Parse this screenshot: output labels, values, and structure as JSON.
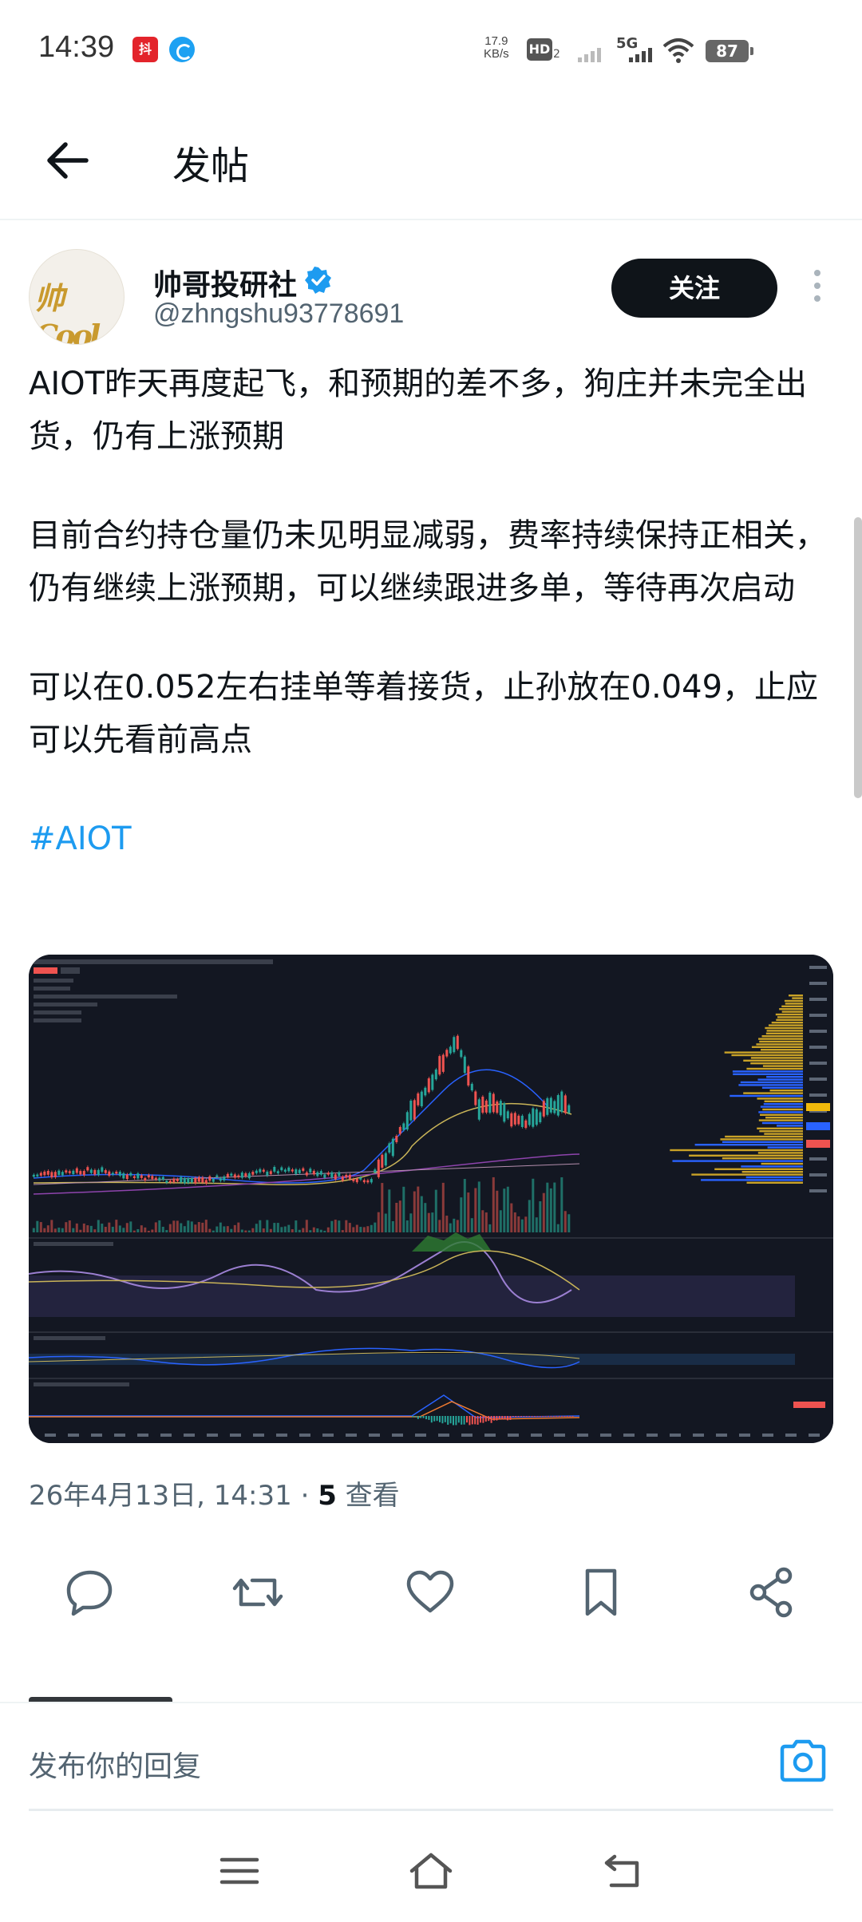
{
  "status_bar": {
    "time": "14:39",
    "app_badge": "抖",
    "net_speed_value": "17.9",
    "net_speed_unit": "KB/s",
    "hd_label": "HD",
    "hd_sub": "2",
    "network": "5G",
    "battery": "87"
  },
  "header": {
    "title": "发帖"
  },
  "author": {
    "avatar_text": "帅Cool",
    "name": "帅哥投研社",
    "handle": "@zhngshu93778691",
    "follow_label": "关注"
  },
  "post": {
    "paragraphs": [
      "AIOT昨天再度起飞，和预期的差不多，狗庄并未完全出货，仍有上涨预期",
      "目前合约持仓量仍未见明显减弱，费率持续保持正相关，仍有继续上涨预期，可以继续跟进多单，等待再次启动",
      "可以在0.052左右挂单等着接货，止孙放在0.049，止应可以先看前高点"
    ],
    "hashtag": "#AIOT",
    "timestamp": "26年4月13日, 14:31 · ",
    "views_count": "5",
    "views_label": " 查看"
  },
  "actions": {
    "reply_icon": "reply-icon",
    "retweet_icon": "retweet-icon",
    "like_icon": "heart-icon",
    "bookmark_icon": "bookmark-icon",
    "share_icon": "share-icon"
  },
  "reply": {
    "placeholder": "发布你的回复"
  },
  "colors": {
    "follow_bg": "#0f1419",
    "link": "#1d9bf0",
    "muted": "#536471",
    "chart_bg": "#131722",
    "candle_up": "#26a69a",
    "candle_down": "#ef5350",
    "volume_profile_gold": "#c9a227",
    "volume_profile_blue": "#2962ff"
  }
}
